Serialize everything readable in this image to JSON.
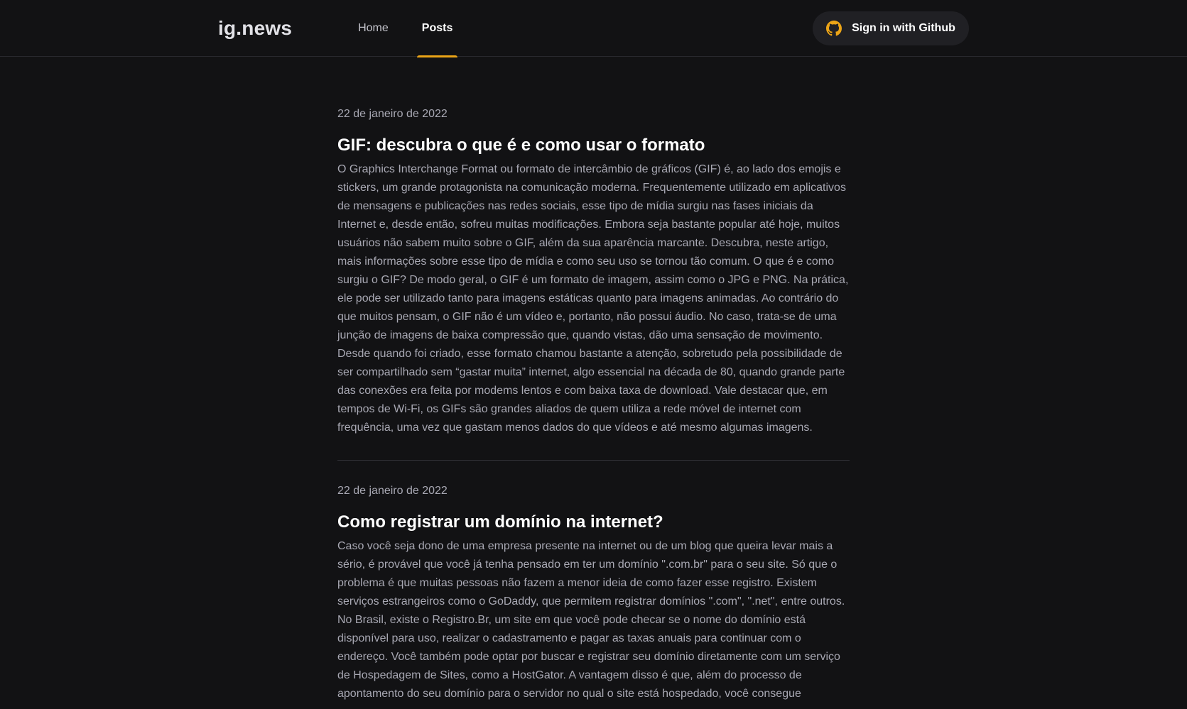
{
  "header": {
    "logo": "ig.news",
    "nav": [
      {
        "label": "Home",
        "active": false
      },
      {
        "label": "Posts",
        "active": true
      }
    ],
    "signin_label": "Sign in with Github",
    "github_icon": "github-icon",
    "accent_color": "#eba417"
  },
  "posts": [
    {
      "date": "22 de janeiro de 2022",
      "title": "GIF: descubra o que é e como usar o formato",
      "excerpt": "O Graphics Interchange Format ou formato de intercâmbio de gráficos (GIF) é, ao lado dos emojis e stickers, um grande protagonista na comunicação moderna. Frequentemente utilizado em aplicativos de mensagens e publicações nas redes sociais, esse tipo de mídia surgiu nas fases iniciais da Internet e, desde então, sofreu muitas modificações. Embora seja bastante popular até hoje, muitos usuários não sabem muito sobre o GIF, além da sua aparência marcante. Descubra, neste artigo, mais informações sobre esse tipo de mídia e como seu uso se tornou tão comum. O que é e como surgiu o GIF? De modo geral, o GIF é um formato de imagem, assim como o JPG e PNG. Na prática, ele pode ser utilizado tanto para imagens estáticas quanto para imagens animadas. Ao contrário do que muitos pensam, o GIF não é um vídeo e, portanto, não possui áudio. No caso, trata-se de uma junção de imagens de baixa compressão que, quando vistas, dão uma sensação de movimento. Desde quando foi criado, esse formato chamou bastante a atenção, sobretudo pela possibilidade de ser compartilhado sem “gastar muita” internet, algo essencial na década de 80, quando grande parte das conexões era feita por modems lentos e com baixa taxa de download. Vale destacar que, em tempos de Wi-Fi, os GIFs são grandes aliados de quem utiliza a rede móvel de internet com frequência, uma vez que gastam menos dados do que vídeos e até mesmo algumas imagens."
    },
    {
      "date": "22 de janeiro de 2022",
      "title": "Como registrar um domínio na internet?",
      "excerpt": "Caso você seja dono de uma empresa presente na internet ou de um blog que queira levar mais a sério, é provável que você já tenha pensado em ter um domínio \".com.br\" para o seu site. Só que o problema é que muitas pessoas não fazem a menor ideia de como fazer esse registro. Existem serviços estrangeiros como o GoDaddy, que permitem registrar domínios \".com\", \".net\", entre outros. No Brasil, existe o Registro.Br, um site em que você pode checar se o nome do domínio está disponível para uso, realizar o cadastramento e pagar as taxas anuais para continuar com o endereço. Você também pode optar por buscar e registrar seu domínio diretamente com um serviço de Hospedagem de Sites, como a HostGator. A vantagem disso é que, além do processo de apontamento do seu domínio para o servidor no qual o site está hospedado, você consegue"
    }
  ]
}
